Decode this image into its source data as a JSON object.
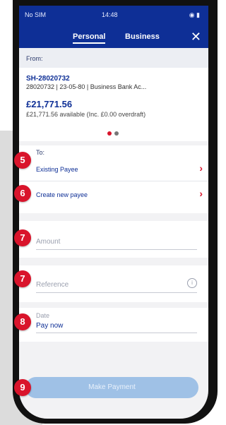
{
  "status": {
    "carrier": "No SIM",
    "time": "14:48"
  },
  "tabs": [
    {
      "label": "Personal"
    },
    {
      "label": "Business"
    }
  ],
  "from": {
    "label": "From:",
    "account_name": "SH-28020732",
    "account_detail": "28020732 | 23-05-80 | Business Bank Ac...",
    "balance": "£21,771.56",
    "available": "£21,771.56 available (Inc. £0.00 overdraft)"
  },
  "to": {
    "label": "To:",
    "existing_payee": "Existing Payee",
    "create_payee": "Create new payee"
  },
  "fields": {
    "amount_placeholder": "Amount",
    "reference_placeholder": "Reference",
    "date_label": "Date",
    "date_value": "Pay now"
  },
  "button": {
    "make_payment": "Make Payment"
  },
  "badges": [
    "5",
    "6",
    "7",
    "7",
    "8",
    "9"
  ]
}
